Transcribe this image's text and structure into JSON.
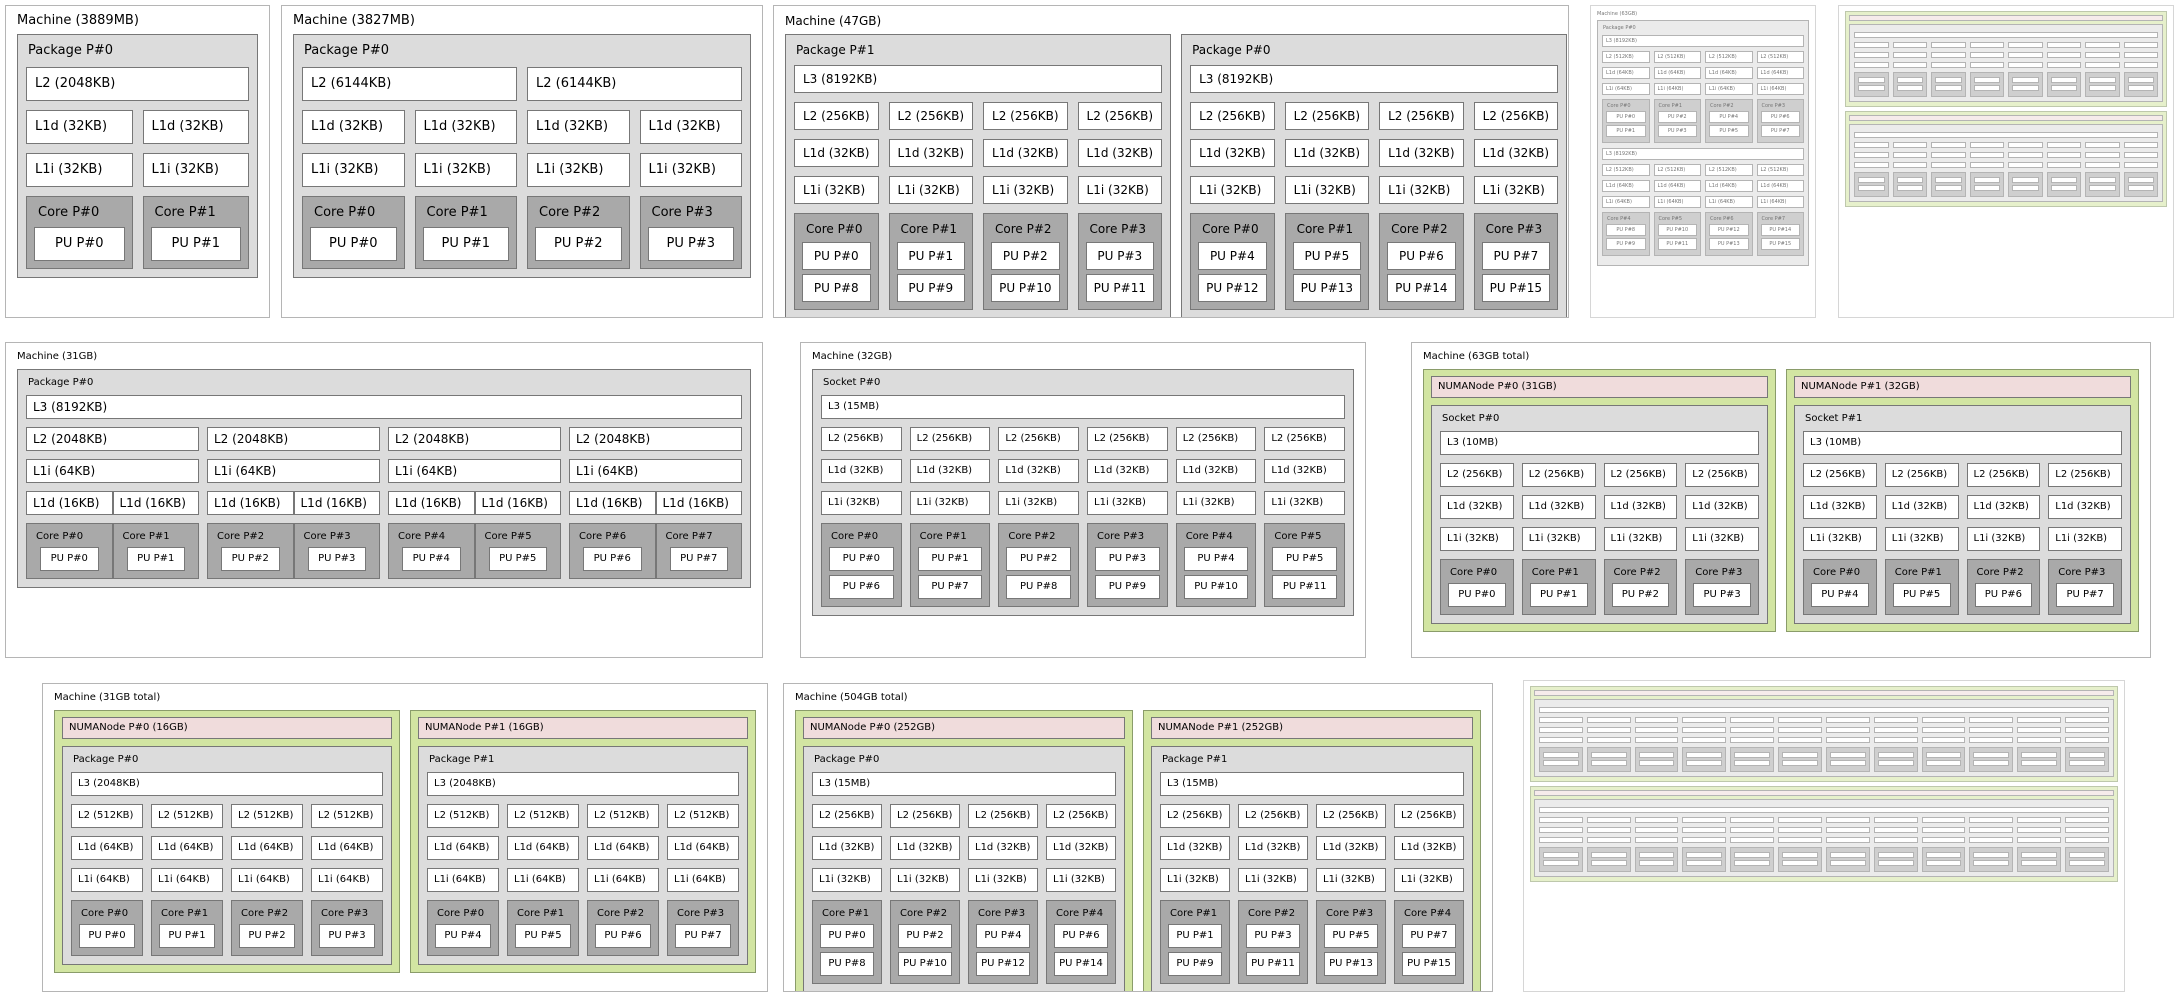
{
  "panels": {
    "m3889": {
      "title": "Machine (3889MB)",
      "package": "Package P#0",
      "l2": [
        "L2 (2048KB)"
      ],
      "l1d": [
        "L1d (32KB)",
        "L1d (32KB)"
      ],
      "l1i": [
        "L1i (32KB)",
        "L1i (32KB)"
      ],
      "cores": [
        {
          "label": "Core P#0",
          "pus": [
            "PU P#0"
          ]
        },
        {
          "label": "Core P#1",
          "pus": [
            "PU P#1"
          ]
        }
      ]
    },
    "m3827": {
      "title": "Machine (3827MB)",
      "package": "Package P#0",
      "l2": [
        "L2 (6144KB)",
        "L2 (6144KB)"
      ],
      "l1d": [
        "L1d (32KB)",
        "L1d (32KB)",
        "L1d (32KB)",
        "L1d (32KB)"
      ],
      "l1i": [
        "L1i (32KB)",
        "L1i (32KB)",
        "L1i (32KB)",
        "L1i (32KB)"
      ],
      "cores": [
        {
          "label": "Core P#0",
          "pus": [
            "PU P#0"
          ]
        },
        {
          "label": "Core P#1",
          "pus": [
            "PU P#1"
          ]
        },
        {
          "label": "Core P#2",
          "pus": [
            "PU P#2"
          ]
        },
        {
          "label": "Core P#3",
          "pus": [
            "PU P#3"
          ]
        }
      ]
    },
    "m47": {
      "title": "Machine (47GB)",
      "packages": [
        {
          "label": "Package P#1",
          "l3": "L3 (8192KB)",
          "l2": [
            "L2 (256KB)",
            "L2 (256KB)",
            "L2 (256KB)",
            "L2 (256KB)"
          ],
          "l1d": [
            "L1d (32KB)",
            "L1d (32KB)",
            "L1d (32KB)",
            "L1d (32KB)"
          ],
          "l1i": [
            "L1i (32KB)",
            "L1i (32KB)",
            "L1i (32KB)",
            "L1i (32KB)"
          ],
          "cores": [
            {
              "label": "Core P#0",
              "pus": [
                "PU P#0",
                "PU P#8"
              ]
            },
            {
              "label": "Core P#1",
              "pus": [
                "PU P#1",
                "PU P#9"
              ]
            },
            {
              "label": "Core P#2",
              "pus": [
                "PU P#2",
                "PU P#10"
              ]
            },
            {
              "label": "Core P#3",
              "pus": [
                "PU P#3",
                "PU P#11"
              ]
            }
          ]
        },
        {
          "label": "Package P#0",
          "l3": "L3 (8192KB)",
          "l2": [
            "L2 (256KB)",
            "L2 (256KB)",
            "L2 (256KB)",
            "L2 (256KB)"
          ],
          "l1d": [
            "L1d (32KB)",
            "L1d (32KB)",
            "L1d (32KB)",
            "L1d (32KB)"
          ],
          "l1i": [
            "L1i (32KB)",
            "L1i (32KB)",
            "L1i (32KB)",
            "L1i (32KB)"
          ],
          "cores": [
            {
              "label": "Core P#0",
              "pus": [
                "PU P#4",
                "PU P#12"
              ]
            },
            {
              "label": "Core P#1",
              "pus": [
                "PU P#5",
                "PU P#13"
              ]
            },
            {
              "label": "Core P#2",
              "pus": [
                "PU P#6",
                "PU P#14"
              ]
            },
            {
              "label": "Core P#3",
              "pus": [
                "PU P#7",
                "PU P#15"
              ]
            }
          ]
        }
      ]
    },
    "m63": {
      "title": "Machine (63GB)",
      "package": "Package P#0",
      "groups": [
        {
          "l3": "L3 (8192KB)",
          "l2": [
            "L2 (512KB)",
            "L2 (512KB)",
            "L2 (512KB)",
            "L2 (512KB)"
          ],
          "l1d": [
            "L1d (64KB)",
            "L1d (64KB)",
            "L1d (64KB)",
            "L1d (64KB)"
          ],
          "l1i": [
            "L1i (64KB)",
            "L1i (64KB)",
            "L1i (64KB)",
            "L1i (64KB)"
          ],
          "cores": [
            {
              "label": "Core P#0",
              "pus": [
                "PU P#0",
                "PU P#1"
              ]
            },
            {
              "label": "Core P#1",
              "pus": [
                "PU P#2",
                "PU P#3"
              ]
            },
            {
              "label": "Core P#2",
              "pus": [
                "PU P#4",
                "PU P#5"
              ]
            },
            {
              "label": "Core P#3",
              "pus": [
                "PU P#6",
                "PU P#7"
              ]
            }
          ]
        },
        {
          "l3": "L3 (8192KB)",
          "l2": [
            "L2 (512KB)",
            "L2 (512KB)",
            "L2 (512KB)",
            "L2 (512KB)"
          ],
          "l1d": [
            "L1d (64KB)",
            "L1d (64KB)",
            "L1d (64KB)",
            "L1d (64KB)"
          ],
          "l1i": [
            "L1i (64KB)",
            "L1i (64KB)",
            "L1i (64KB)",
            "L1i (64KB)"
          ],
          "cores": [
            {
              "label": "Core P#4",
              "pus": [
                "PU P#8",
                "PU P#9"
              ]
            },
            {
              "label": "Core P#5",
              "pus": [
                "PU P#10",
                "PU P#11"
              ]
            },
            {
              "label": "Core P#6",
              "pus": [
                "PU P#12",
                "PU P#13"
              ]
            },
            {
              "label": "Core P#7",
              "pus": [
                "PU P#14",
                "PU P#15"
              ]
            }
          ]
        }
      ]
    },
    "m31": {
      "title": "Machine (31GB)",
      "package": "Package P#0",
      "l3": "L3 (8192KB)",
      "l2": [
        "L2 (2048KB)",
        "L2 (2048KB)",
        "L2 (2048KB)",
        "L2 (2048KB)"
      ],
      "l1i": [
        "L1i (64KB)",
        "L1i (64KB)",
        "L1i (64KB)",
        "L1i (64KB)"
      ],
      "l1d": [
        "L1d (16KB)",
        "L1d (16KB)",
        "L1d (16KB)",
        "L1d (16KB)",
        "L1d (16KB)",
        "L1d (16KB)",
        "L1d (16KB)",
        "L1d (16KB)"
      ],
      "cores": [
        {
          "label": "Core P#0",
          "pus": [
            "PU P#0"
          ]
        },
        {
          "label": "Core P#1",
          "pus": [
            "PU P#1"
          ]
        },
        {
          "label": "Core P#2",
          "pus": [
            "PU P#2"
          ]
        },
        {
          "label": "Core P#3",
          "pus": [
            "PU P#3"
          ]
        },
        {
          "label": "Core P#4",
          "pus": [
            "PU P#4"
          ]
        },
        {
          "label": "Core P#5",
          "pus": [
            "PU P#5"
          ]
        },
        {
          "label": "Core P#6",
          "pus": [
            "PU P#6"
          ]
        },
        {
          "label": "Core P#7",
          "pus": [
            "PU P#7"
          ]
        }
      ]
    },
    "m32": {
      "title": "Machine (32GB)",
      "socket": "Socket P#0",
      "l3": "L3 (15MB)",
      "l2": [
        "L2 (256KB)",
        "L2 (256KB)",
        "L2 (256KB)",
        "L2 (256KB)",
        "L2 (256KB)",
        "L2 (256KB)"
      ],
      "l1d": [
        "L1d (32KB)",
        "L1d (32KB)",
        "L1d (32KB)",
        "L1d (32KB)",
        "L1d (32KB)",
        "L1d (32KB)"
      ],
      "l1i": [
        "L1i (32KB)",
        "L1i (32KB)",
        "L1i (32KB)",
        "L1i (32KB)",
        "L1i (32KB)",
        "L1i (32KB)"
      ],
      "cores": [
        {
          "label": "Core P#0",
          "pus": [
            "PU P#0",
            "PU P#6"
          ]
        },
        {
          "label": "Core P#1",
          "pus": [
            "PU P#1",
            "PU P#7"
          ]
        },
        {
          "label": "Core P#2",
          "pus": [
            "PU P#2",
            "PU P#8"
          ]
        },
        {
          "label": "Core P#3",
          "pus": [
            "PU P#3",
            "PU P#9"
          ]
        },
        {
          "label": "Core P#4",
          "pus": [
            "PU P#4",
            "PU P#10"
          ]
        },
        {
          "label": "Core P#5",
          "pus": [
            "PU P#5",
            "PU P#11"
          ]
        }
      ]
    },
    "m63t": {
      "title": "Machine (63GB total)",
      "nodes": [
        {
          "numa": "NUMANode P#0 (31GB)",
          "socket": "Socket P#0",
          "l3": "L3 (10MB)",
          "l2": [
            "L2 (256KB)",
            "L2 (256KB)",
            "L2 (256KB)",
            "L2 (256KB)"
          ],
          "l1d": [
            "L1d (32KB)",
            "L1d (32KB)",
            "L1d (32KB)",
            "L1d (32KB)"
          ],
          "l1i": [
            "L1i (32KB)",
            "L1i (32KB)",
            "L1i (32KB)",
            "L1i (32KB)"
          ],
          "cores": [
            {
              "label": "Core P#0",
              "pus": [
                "PU P#0"
              ]
            },
            {
              "label": "Core P#1",
              "pus": [
                "PU P#1"
              ]
            },
            {
              "label": "Core P#2",
              "pus": [
                "PU P#2"
              ]
            },
            {
              "label": "Core P#3",
              "pus": [
                "PU P#3"
              ]
            }
          ]
        },
        {
          "numa": "NUMANode P#1 (32GB)",
          "socket": "Socket P#1",
          "l3": "L3 (10MB)",
          "l2": [
            "L2 (256KB)",
            "L2 (256KB)",
            "L2 (256KB)",
            "L2 (256KB)"
          ],
          "l1d": [
            "L1d (32KB)",
            "L1d (32KB)",
            "L1d (32KB)",
            "L1d (32KB)"
          ],
          "l1i": [
            "L1i (32KB)",
            "L1i (32KB)",
            "L1i (32KB)",
            "L1i (32KB)"
          ],
          "cores": [
            {
              "label": "Core P#0",
              "pus": [
                "PU P#4"
              ]
            },
            {
              "label": "Core P#1",
              "pus": [
                "PU P#5"
              ]
            },
            {
              "label": "Core P#2",
              "pus": [
                "PU P#6"
              ]
            },
            {
              "label": "Core P#3",
              "pus": [
                "PU P#7"
              ]
            }
          ]
        }
      ]
    },
    "m31t": {
      "title": "Machine (31GB total)",
      "nodes": [
        {
          "numa": "NUMANode P#0 (16GB)",
          "package": "Package P#0",
          "l3": "L3 (2048KB)",
          "l2": [
            "L2 (512KB)",
            "L2 (512KB)",
            "L2 (512KB)",
            "L2 (512KB)"
          ],
          "l1d": [
            "L1d (64KB)",
            "L1d (64KB)",
            "L1d (64KB)",
            "L1d (64KB)"
          ],
          "l1i": [
            "L1i (64KB)",
            "L1i (64KB)",
            "L1i (64KB)",
            "L1i (64KB)"
          ],
          "cores": [
            {
              "label": "Core P#0",
              "pus": [
                "PU P#0"
              ]
            },
            {
              "label": "Core P#1",
              "pus": [
                "PU P#1"
              ]
            },
            {
              "label": "Core P#2",
              "pus": [
                "PU P#2"
              ]
            },
            {
              "label": "Core P#3",
              "pus": [
                "PU P#3"
              ]
            }
          ]
        },
        {
          "numa": "NUMANode P#1 (16GB)",
          "package": "Package P#1",
          "l3": "L3 (2048KB)",
          "l2": [
            "L2 (512KB)",
            "L2 (512KB)",
            "L2 (512KB)",
            "L2 (512KB)"
          ],
          "l1d": [
            "L1d (64KB)",
            "L1d (64KB)",
            "L1d (64KB)",
            "L1d (64KB)"
          ],
          "l1i": [
            "L1i (64KB)",
            "L1i (64KB)",
            "L1i (64KB)",
            "L1i (64KB)"
          ],
          "cores": [
            {
              "label": "Core P#0",
              "pus": [
                "PU P#4"
              ]
            },
            {
              "label": "Core P#1",
              "pus": [
                "PU P#5"
              ]
            },
            {
              "label": "Core P#2",
              "pus": [
                "PU P#6"
              ]
            },
            {
              "label": "Core P#3",
              "pus": [
                "PU P#7"
              ]
            }
          ]
        }
      ]
    },
    "m504t": {
      "title": "Machine (504GB total)",
      "nodes": [
        {
          "numa": "NUMANode P#0 (252GB)",
          "package": "Package P#0",
          "l3": "L3 (15MB)",
          "l2": [
            "L2 (256KB)",
            "L2 (256KB)",
            "L2 (256KB)",
            "L2 (256KB)"
          ],
          "l1d": [
            "L1d (32KB)",
            "L1d (32KB)",
            "L1d (32KB)",
            "L1d (32KB)"
          ],
          "l1i": [
            "L1i (32KB)",
            "L1i (32KB)",
            "L1i (32KB)",
            "L1i (32KB)"
          ],
          "cores": [
            {
              "label": "Core P#1",
              "pus": [
                "PU P#0",
                "PU P#8"
              ]
            },
            {
              "label": "Core P#2",
              "pus": [
                "PU P#2",
                "PU P#10"
              ]
            },
            {
              "label": "Core P#3",
              "pus": [
                "PU P#4",
                "PU P#12"
              ]
            },
            {
              "label": "Core P#4",
              "pus": [
                "PU P#6",
                "PU P#14"
              ]
            }
          ]
        },
        {
          "numa": "NUMANode P#1 (252GB)",
          "package": "Package P#1",
          "l3": "L3 (15MB)",
          "l2": [
            "L2 (256KB)",
            "L2 (256KB)",
            "L2 (256KB)",
            "L2 (256KB)"
          ],
          "l1d": [
            "L1d (32KB)",
            "L1d (32KB)",
            "L1d (32KB)",
            "L1d (32KB)"
          ],
          "l1i": [
            "L1i (32KB)",
            "L1i (32KB)",
            "L1i (32KB)",
            "L1i (32KB)"
          ],
          "cores": [
            {
              "label": "Core P#1",
              "pus": [
                "PU P#1",
                "PU P#9"
              ]
            },
            {
              "label": "Core P#2",
              "pus": [
                "PU P#3",
                "PU P#11"
              ]
            },
            {
              "label": "Core P#3",
              "pus": [
                "PU P#5",
                "PU P#13"
              ]
            },
            {
              "label": "Core P#4",
              "pus": [
                "PU P#7",
                "PU P#15"
              ]
            }
          ]
        }
      ]
    }
  }
}
